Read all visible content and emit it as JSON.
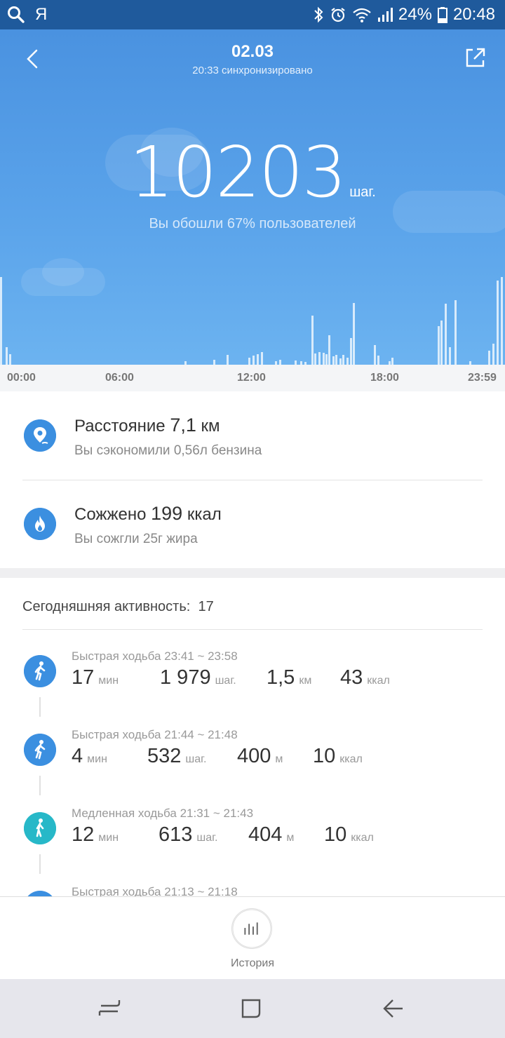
{
  "status_bar": {
    "left_icons": [
      "search-icon"
    ],
    "left_text": "Я",
    "right_icons": [
      "bluetooth-icon",
      "alarm-icon",
      "wifi-icon",
      "signal-icon"
    ],
    "battery": "24%",
    "time": "20:48"
  },
  "header": {
    "date": "02.03",
    "sync_text": "20:33 синхронизировано",
    "steps": "10203",
    "steps_unit": "шаг.",
    "subtitle": "Вы обошли 67% пользователей"
  },
  "chart_data": {
    "type": "bar",
    "x_tick_labels": [
      "00:00",
      "06:00",
      "12:00",
      "18:00",
      "23:59"
    ],
    "xlim": [
      "00:00",
      "23:59"
    ],
    "color": "#ffffff",
    "values": [
      [
        0,
        125
      ],
      [
        8,
        25
      ],
      [
        13,
        15
      ],
      [
        263,
        5
      ],
      [
        304,
        7
      ],
      [
        323,
        14
      ],
      [
        354,
        10
      ],
      [
        360,
        13
      ],
      [
        366,
        15
      ],
      [
        372,
        18
      ],
      [
        392,
        5
      ],
      [
        398,
        7
      ],
      [
        420,
        6
      ],
      [
        428,
        5
      ],
      [
        434,
        4
      ],
      [
        444,
        70
      ],
      [
        448,
        16
      ],
      [
        454,
        18
      ],
      [
        460,
        17
      ],
      [
        464,
        15
      ],
      [
        468,
        42
      ],
      [
        474,
        12
      ],
      [
        478,
        14
      ],
      [
        484,
        9
      ],
      [
        488,
        14
      ],
      [
        494,
        10
      ],
      [
        499,
        38
      ],
      [
        503,
        88
      ],
      [
        533,
        28
      ],
      [
        538,
        13
      ],
      [
        554,
        5
      ],
      [
        558,
        10
      ],
      [
        624,
        55
      ],
      [
        628,
        63
      ],
      [
        634,
        87
      ],
      [
        640,
        25
      ],
      [
        648,
        92
      ],
      [
        669,
        5
      ],
      [
        696,
        20
      ],
      [
        702,
        30
      ],
      [
        708,
        120
      ],
      [
        714,
        125
      ]
    ],
    "value_note": "pairs of [horizontal position along the 0-720 time axis, relative bar height]"
  },
  "summary": {
    "distance": {
      "label": "Расстояние",
      "value": "7,1",
      "unit": "км",
      "sub": "Вы сэкономили 0,56л бензина",
      "icon": "location-pin-icon"
    },
    "calories": {
      "label": "Сожжено",
      "value": "199",
      "unit": "ккал",
      "sub": "Вы сожгли 25г жира",
      "icon": "flame-icon"
    }
  },
  "activity": {
    "heading": "Сегодняшняя активность:",
    "count": "17",
    "items": [
      {
        "title": "Быстрая ходьба 23:41 ~ 23:58",
        "type": "fast",
        "dur": "17",
        "dur_u": "мин",
        "steps": "1 979",
        "steps_u": "шаг.",
        "dist": "1,5",
        "dist_u": "км",
        "kcal": "43",
        "kcal_u": "ккал"
      },
      {
        "title": "Быстрая ходьба 21:44 ~ 21:48",
        "type": "fast",
        "dur": "4",
        "dur_u": "мин",
        "steps": "532",
        "steps_u": "шаг.",
        "dist": "400",
        "dist_u": "м",
        "kcal": "10",
        "kcal_u": "ккал"
      },
      {
        "title": "Медленная ходьба 21:31 ~ 21:43",
        "type": "slow",
        "dur": "12",
        "dur_u": "мин",
        "steps": "613",
        "steps_u": "шаг.",
        "dist": "404",
        "dist_u": "м",
        "kcal": "10",
        "kcal_u": "ккал"
      },
      {
        "title": "Быстрая ходьба 21:13 ~ 21:18",
        "type": "fast"
      }
    ]
  },
  "bottom": {
    "history_label": "История"
  },
  "colors": {
    "accent": "#3b8fe0",
    "slow": "#27b8c8",
    "hero_top": "#4a92e0",
    "status_bar": "#1f5a9c"
  }
}
